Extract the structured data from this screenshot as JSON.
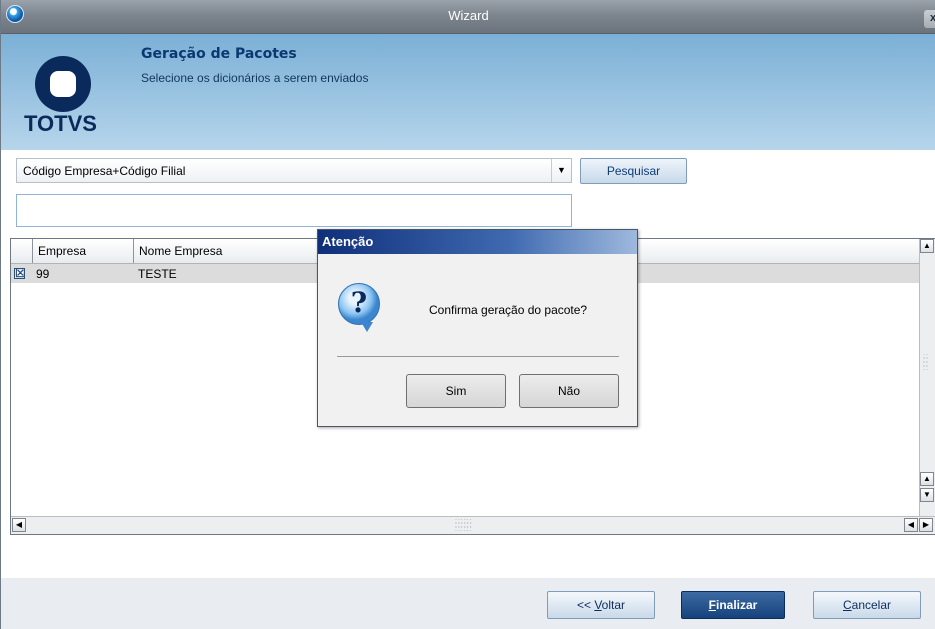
{
  "window": {
    "title": "Wizard",
    "close_label": "x"
  },
  "header": {
    "logo_text": "TOTVS",
    "title": "Geração de Pacotes",
    "subtitle": "Selecione os dicionários a serem enviados"
  },
  "search": {
    "index_value": "Código Empresa+Código Filial",
    "button_label": "Pesquisar",
    "input_value": ""
  },
  "grid": {
    "columns": [
      "Empresa",
      "Nome Empresa"
    ],
    "rows": [
      {
        "checked": true,
        "check_glyph": "☒",
        "empresa": "99",
        "nome": "TESTE"
      }
    ]
  },
  "dialog": {
    "title": "Atenção",
    "message": "Confirma geração do pacote?",
    "yes_label": "Sim",
    "no_label": "Não",
    "icon": "question-icon"
  },
  "footer": {
    "back_prefix": "<< ",
    "back_underline": "V",
    "back_rest": "oltar",
    "finish_underline": "F",
    "finish_rest": "inalizar",
    "cancel_underline": "C",
    "cancel_rest": "ancelar"
  }
}
